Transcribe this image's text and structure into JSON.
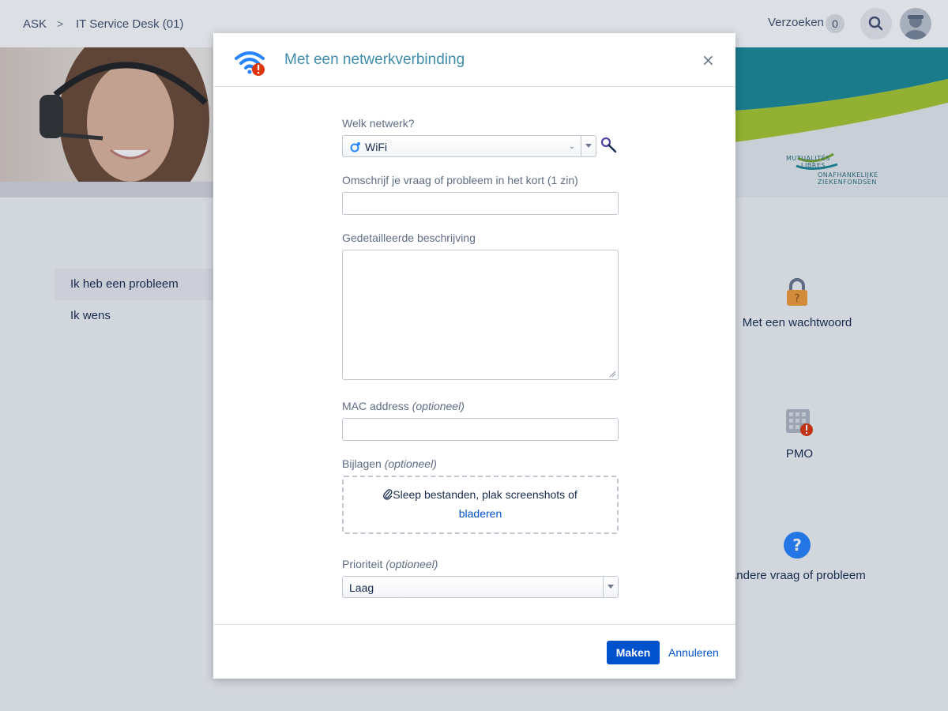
{
  "header": {
    "breadcrumb": [
      "ASK",
      "IT Service Desk (01)"
    ],
    "breadcrumb_separator": ">",
    "requests_label": "Verzoeken",
    "requests_count": "0"
  },
  "banner": {
    "logo_line1": "MUTUALITÉS",
    "logo_line2": "LIBRES",
    "logo_line3": "ONAFHANKELIJKE",
    "logo_line4": "ZIEKENFONDSEN"
  },
  "sidebar": {
    "items": [
      {
        "label": "Ik heb een probleem",
        "active": true
      },
      {
        "label": "Ik wens",
        "active": false
      }
    ]
  },
  "tiles": [
    {
      "label": "Met een wachtwoord",
      "icon": "lock-question-icon"
    },
    {
      "label": "PMO",
      "icon": "calendar-alert-icon"
    },
    {
      "label": "Andere vraag of probleem",
      "icon": "question-circle-icon"
    }
  ],
  "modal": {
    "title": "Met een netwerkverbinding",
    "header_icon": "wifi-alert-icon",
    "close_label": "×",
    "fields": {
      "network": {
        "label": "Welk netwerk?",
        "value": "WiFi"
      },
      "summary": {
        "label": "Omschrijf je vraag of probleem in het kort (1 zin)",
        "value": ""
      },
      "description": {
        "label": "Gedetailleerde beschrijving",
        "value": ""
      },
      "mac": {
        "label": "MAC address",
        "optional": "(optioneel)",
        "value": ""
      },
      "attachments": {
        "label": "Bijlagen",
        "optional": "(optioneel)",
        "drop_text": "Sleep bestanden, plak screenshots of",
        "browse_link": "bladeren"
      },
      "priority": {
        "label": "Prioriteit",
        "optional": "(optioneel)",
        "value": "Laag"
      }
    },
    "footer": {
      "submit_label": "Maken",
      "cancel_label": "Annuleren"
    }
  },
  "colors": {
    "title": "#3f8cab",
    "primary": "#0052cc",
    "alert": "#de350b",
    "wifi": "#2684ff"
  }
}
